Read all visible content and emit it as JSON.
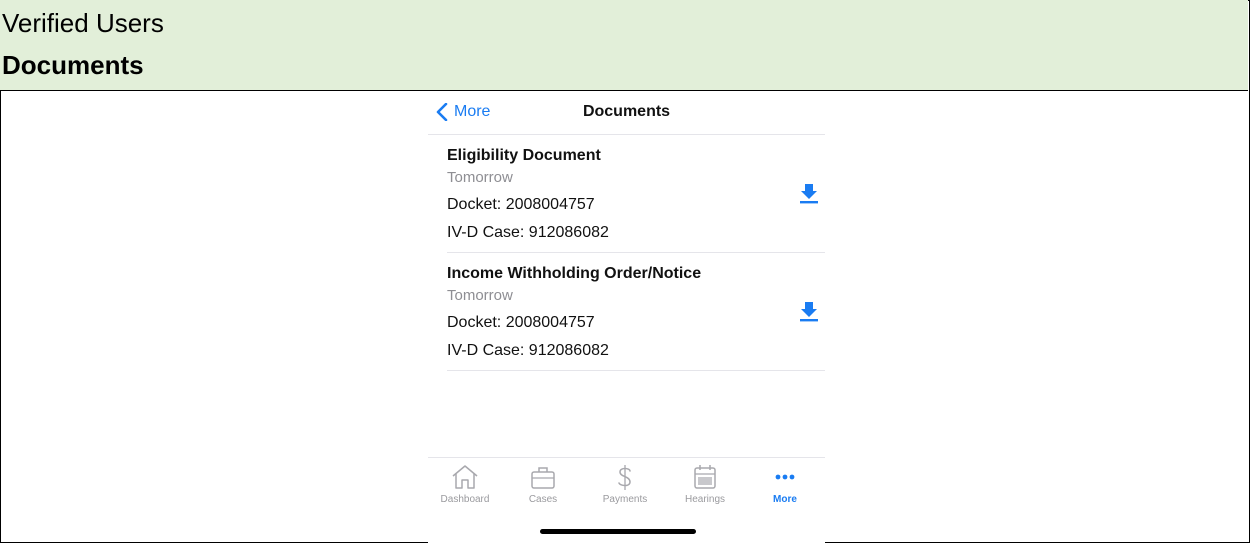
{
  "header": {
    "line1": "Verified Users",
    "line2": "Documents"
  },
  "navbar": {
    "back_label": "More",
    "title": "Documents"
  },
  "documents": [
    {
      "title": "Eligibility Document",
      "date": "Tomorrow",
      "docket": "Docket: 2008004757",
      "case": "IV-D Case: 912086082"
    },
    {
      "title": "Income Withholding Order/Notice",
      "date": "Tomorrow",
      "docket": "Docket: 2008004757",
      "case": "IV-D Case: 912086082"
    }
  ],
  "tabs": [
    {
      "label": "Dashboard",
      "icon": "home-icon"
    },
    {
      "label": "Cases",
      "icon": "briefcase-icon"
    },
    {
      "label": "Payments",
      "icon": "dollar-icon"
    },
    {
      "label": "Hearings",
      "icon": "calendar-icon"
    },
    {
      "label": "More",
      "icon": "more-dots-icon",
      "active": true
    }
  ],
  "colors": {
    "accent": "#1a7cf2",
    "header_bg": "#e2efd9",
    "muted": "#8e8e93"
  }
}
